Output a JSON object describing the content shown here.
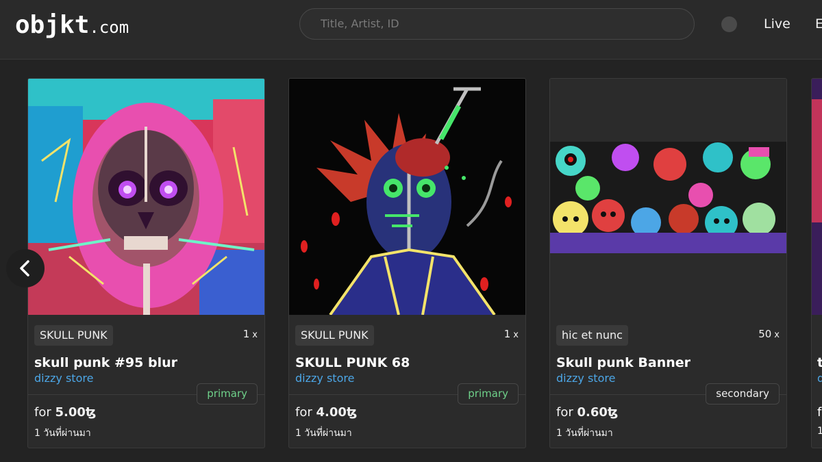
{
  "header": {
    "logo_main": "objkt",
    "logo_tld": ".com",
    "search_placeholder": "Title, Artist, ID",
    "nav_live": "Live",
    "nav_partial": "E"
  },
  "cards": [
    {
      "tag": "SKULL PUNK",
      "editions": "1",
      "editions_suffix": "x",
      "title": "skull punk #95 blur",
      "artist": "dizzy store",
      "badge": "primary",
      "price_prefix": "for",
      "price": "5.00ꜩ",
      "time_ago": "1 วันที่ผ่านมา"
    },
    {
      "tag": "SKULL PUNK",
      "editions": "1",
      "editions_suffix": "x",
      "title": "SKULL PUNK 68",
      "artist": "dizzy store",
      "badge": "primary",
      "price_prefix": "for",
      "price": "4.00ꜩ",
      "time_ago": "1 วันที่ผ่านมา"
    },
    {
      "tag": "hic et nunc",
      "editions": "50",
      "editions_suffix": "x",
      "title": "Skull punk Banner",
      "artist": "dizzy store",
      "badge": "secondary",
      "price_prefix": "for",
      "price": "0.60ꜩ",
      "time_ago": "1 วันที่ผ่านมา"
    }
  ],
  "partial_card": {
    "title_initial": "t",
    "artist_initial": "d",
    "price_initial": "f",
    "ago_initial": "1"
  },
  "colors": {
    "background": "#232323",
    "card": "#2b2b2b",
    "artist_link": "#4ca6e6",
    "primary_badge": "#6fd18a"
  },
  "icons": {
    "prev": "chevron-left-icon",
    "theme": "theme-toggle-icon"
  }
}
